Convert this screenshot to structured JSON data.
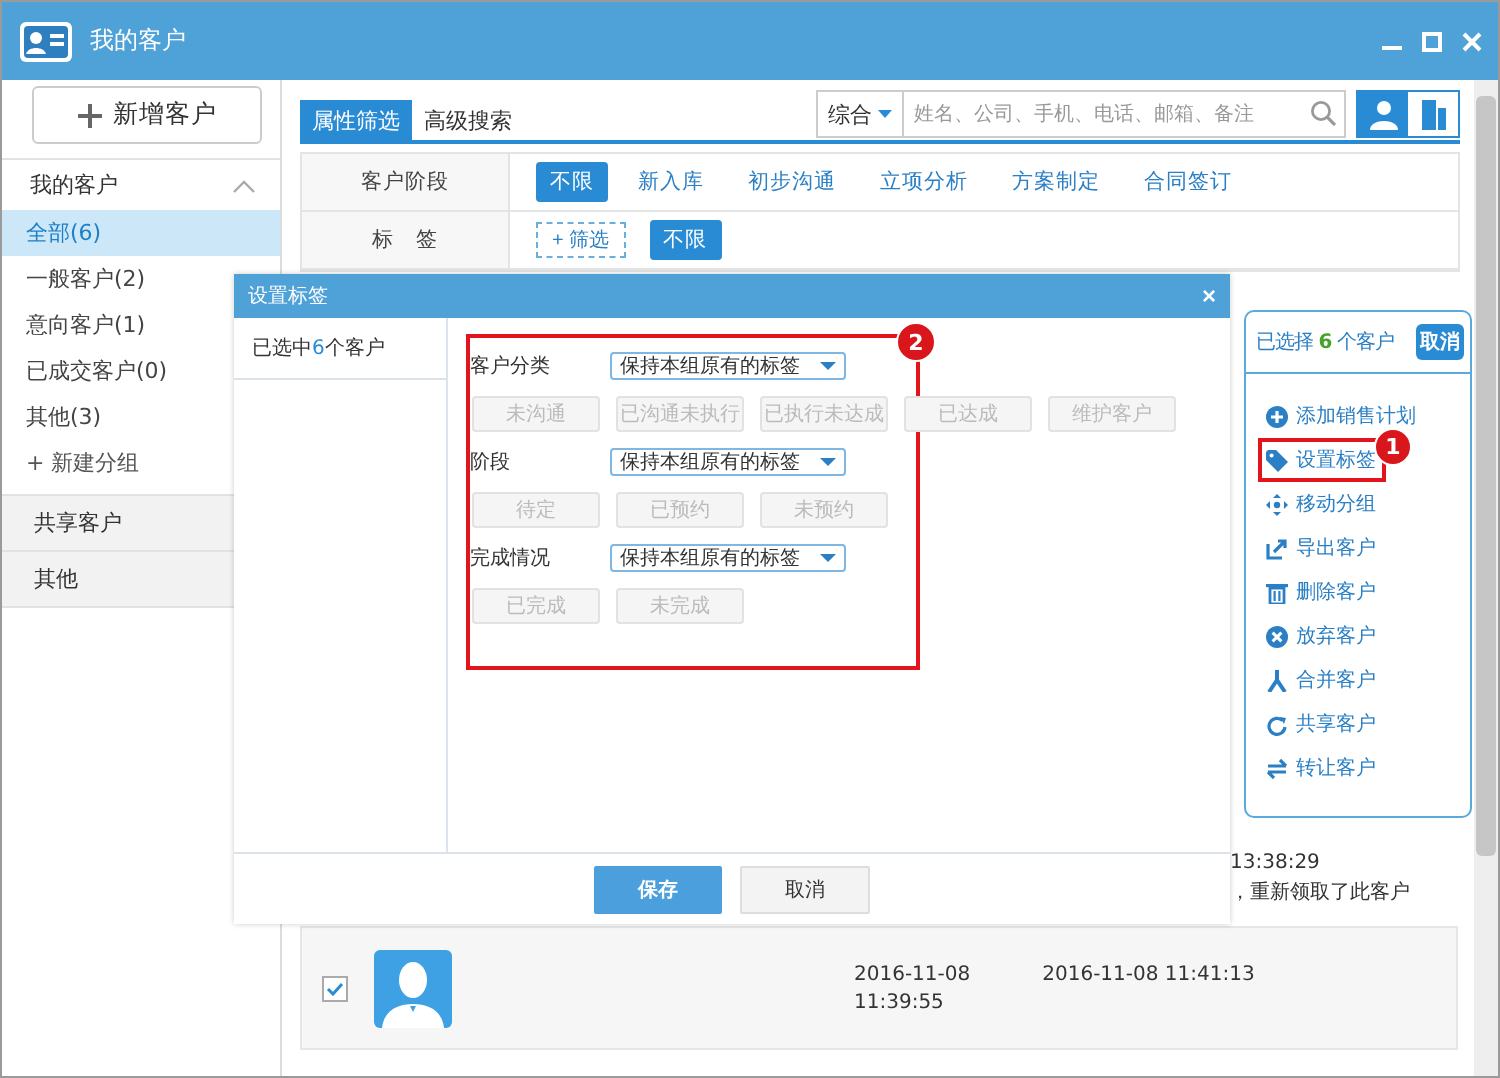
{
  "window": {
    "title": "我的客户"
  },
  "sidebar": {
    "new_button": "新增客户",
    "sections": [
      {
        "label": "我的客户",
        "expanded": true,
        "items": [
          {
            "label": "全部(6)",
            "selected": true
          },
          {
            "label": "一般客户(2)",
            "selected": false
          },
          {
            "label": "意向客户(1)",
            "selected": false
          },
          {
            "label": "已成交客户(0)",
            "selected": false
          },
          {
            "label": "其他(3)",
            "selected": false
          }
        ],
        "add_group": "+ 新建分组"
      },
      {
        "label": "共享客户",
        "expanded": false
      },
      {
        "label": "其他",
        "expanded": false
      }
    ]
  },
  "tabs": [
    {
      "label": "属性筛选",
      "selected": true
    },
    {
      "label": "高级搜索",
      "selected": false
    }
  ],
  "search": {
    "scope": "综合",
    "placeholder": "姓名、公司、手机、电话、邮箱、备注"
  },
  "view_toggle": [
    {
      "kind": "person",
      "selected": true
    },
    {
      "kind": "card",
      "selected": false
    }
  ],
  "filters": [
    {
      "label": "客户阶段",
      "options": [
        {
          "label": "不限",
          "selected": true
        },
        {
          "label": "新入库",
          "selected": false
        },
        {
          "label": "初步沟通",
          "selected": false
        },
        {
          "label": "立项分析",
          "selected": false
        },
        {
          "label": "方案制定",
          "selected": false
        },
        {
          "label": "合同签订",
          "selected": false
        }
      ]
    },
    {
      "label": "标　签",
      "add_button": "+ 筛选",
      "options": [
        {
          "label": "不限",
          "selected": true
        }
      ]
    }
  ],
  "list": {
    "rows": [
      {
        "kind": "partial",
        "time": "13:38:29",
        "note": "，重新领取了此客户"
      },
      {
        "kind": "full",
        "checked": true,
        "created_date": "2016-11-08",
        "created_time": "11:39:55",
        "updated": "2016-11-08 11:41:13"
      }
    ]
  },
  "dialog": {
    "title": "设置标签",
    "close": "×",
    "selected_prefix": "已选中",
    "selected_count": "6",
    "selected_suffix": "个客户",
    "annotation": "2",
    "groups": [
      {
        "label": "客户分类",
        "select": "保持本组原有的标签",
        "options": [
          {
            "label": "未沟通",
            "disabled": true
          },
          {
            "label": "已沟通未执行",
            "disabled": true
          },
          {
            "label": "已执行未达成",
            "disabled": true
          },
          {
            "label": "已达成",
            "disabled": true
          },
          {
            "label": "维护客户",
            "disabled": true
          }
        ]
      },
      {
        "label": "阶段",
        "select": "保持本组原有的标签",
        "options": [
          {
            "label": "待定",
            "disabled": true
          },
          {
            "label": "已预约",
            "disabled": true
          },
          {
            "label": "未预约",
            "disabled": true
          }
        ]
      },
      {
        "label": "完成情况",
        "select": "保持本组原有的标签",
        "options": [
          {
            "label": "已完成",
            "disabled": true
          },
          {
            "label": "未完成",
            "disabled": true
          }
        ]
      }
    ],
    "buttons": [
      {
        "label": "保存",
        "kind": "primary"
      },
      {
        "label": "取消",
        "kind": "secondary"
      }
    ]
  },
  "panel": {
    "prefix": "已选择",
    "count": "6",
    "suffix": "个客户",
    "cancel": "取消",
    "items": [
      {
        "label": "添加销售计划",
        "kind": "add"
      },
      {
        "label": "设置标签",
        "kind": "tag",
        "annotation": "1"
      },
      {
        "label": "移动分组",
        "kind": "move"
      },
      {
        "label": "导出客户",
        "kind": "export"
      },
      {
        "label": "删除客户",
        "kind": "delete"
      },
      {
        "label": "放弃客户",
        "kind": "abandon"
      },
      {
        "label": "合并客户",
        "kind": "merge"
      },
      {
        "label": "共享客户",
        "kind": "share"
      },
      {
        "label": "转让客户",
        "kind": "transfer"
      }
    ]
  }
}
